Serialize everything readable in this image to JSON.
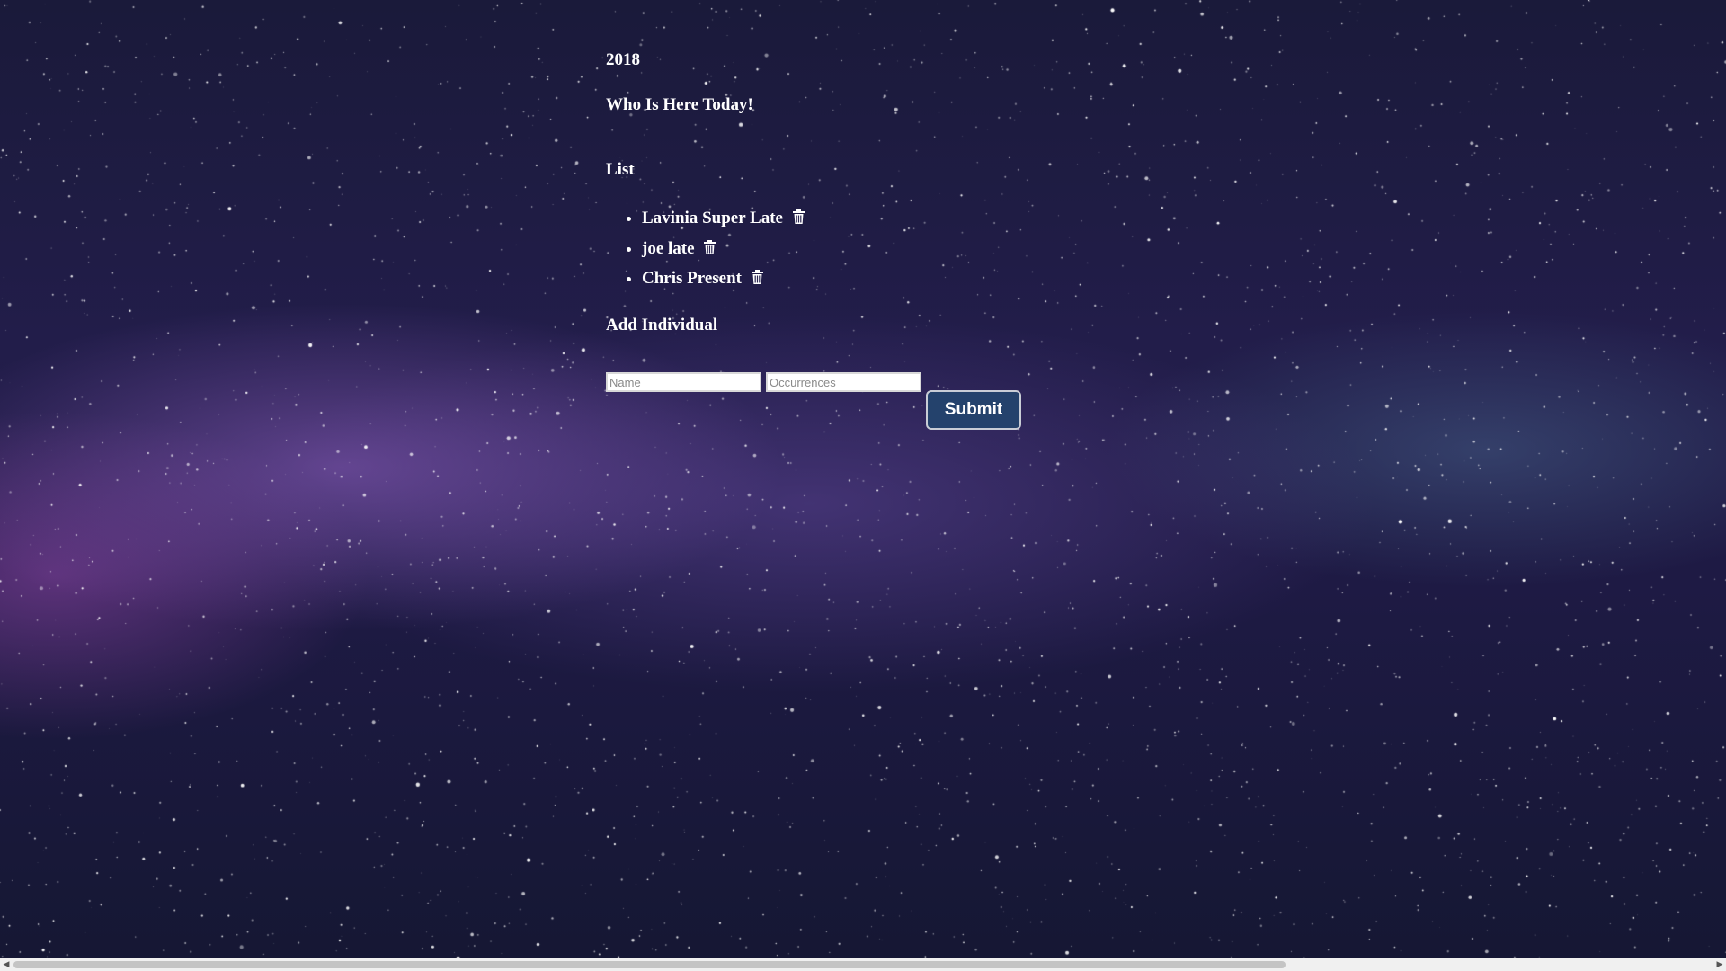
{
  "page": {
    "year": "2018",
    "title": "Who Is Here Today!"
  },
  "list": {
    "heading": "List",
    "items": [
      {
        "name": "Lavinia",
        "status": "Super Late",
        "icon": "trash-icon"
      },
      {
        "name": "joe",
        "status": "late",
        "icon": "trash-icon"
      },
      {
        "name": "Chris",
        "status": "Present",
        "icon": "trash-icon"
      }
    ]
  },
  "form": {
    "heading": "Add Individual",
    "name_placeholder": "Name",
    "name_value": "",
    "occurrences_placeholder": "Occurrences",
    "occurrences_value": "",
    "submit_label": "Submit"
  },
  "colors": {
    "submit_background": "#24426c",
    "text": "#ffffff",
    "background": "#1e1a44"
  },
  "scrollbar": {
    "left_arrow": "◀",
    "right_arrow": "▶"
  }
}
